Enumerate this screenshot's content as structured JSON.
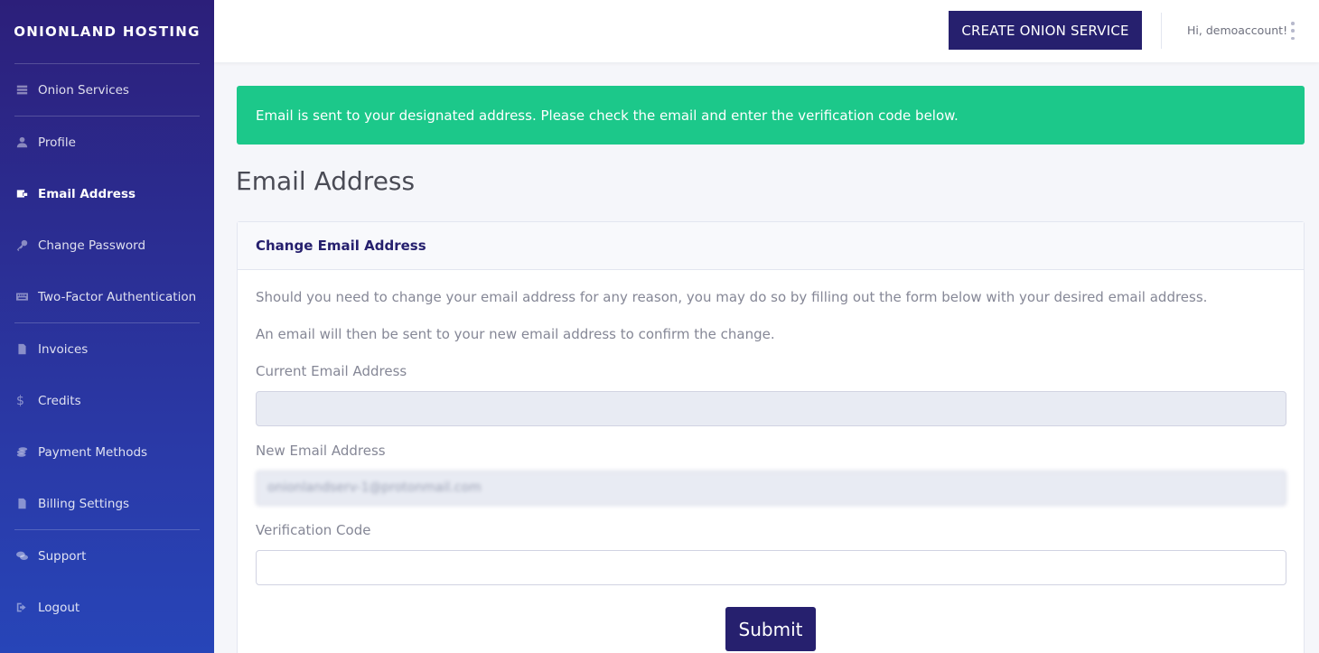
{
  "brand": {
    "name": "ONIONLAND HOSTING"
  },
  "sidebar": {
    "items": [
      {
        "label": "Onion Services",
        "icon": "server-icon"
      },
      {
        "label": "Profile",
        "icon": "user-icon"
      },
      {
        "label": "Email Address",
        "icon": "mail-icon",
        "active": true
      },
      {
        "label": "Change Password",
        "icon": "key-icon"
      },
      {
        "label": "Two-Factor Authentication",
        "icon": "keyboard-icon"
      },
      {
        "label": "Invoices",
        "icon": "file-invoice-icon"
      },
      {
        "label": "Credits",
        "icon": "dollar-icon"
      },
      {
        "label": "Payment Methods",
        "icon": "coins-icon"
      },
      {
        "label": "Billing Settings",
        "icon": "file-icon"
      },
      {
        "label": "Support",
        "icon": "comments-icon"
      },
      {
        "label": "Logout",
        "icon": "sign-out-icon"
      }
    ]
  },
  "topbar": {
    "create_label": "CREATE ONION SERVICE",
    "greeting": "Hi, demoaccount!"
  },
  "alert": {
    "message": "Email is sent to your designated address. Please check the email and enter the verification code below."
  },
  "page": {
    "title": "Email Address"
  },
  "card": {
    "header": "Change Email Address",
    "para1": "Should you need to change your email address for any reason, you may do so by filling out the form below with your desired email address.",
    "para2": "An email will then be sent to your new email address to confirm the change.",
    "current_label": "Current Email Address",
    "current_value": "",
    "new_label": "New Email Address",
    "new_value": "onionlandserv-1@protonmail.com",
    "code_label": "Verification Code",
    "code_value": "",
    "submit_label": "Submit"
  },
  "colors": {
    "sidebar_top": "#2c1f7a",
    "sidebar_bottom": "#2745b8",
    "primary_button": "#26206e",
    "success_alert": "#1cc88a"
  }
}
